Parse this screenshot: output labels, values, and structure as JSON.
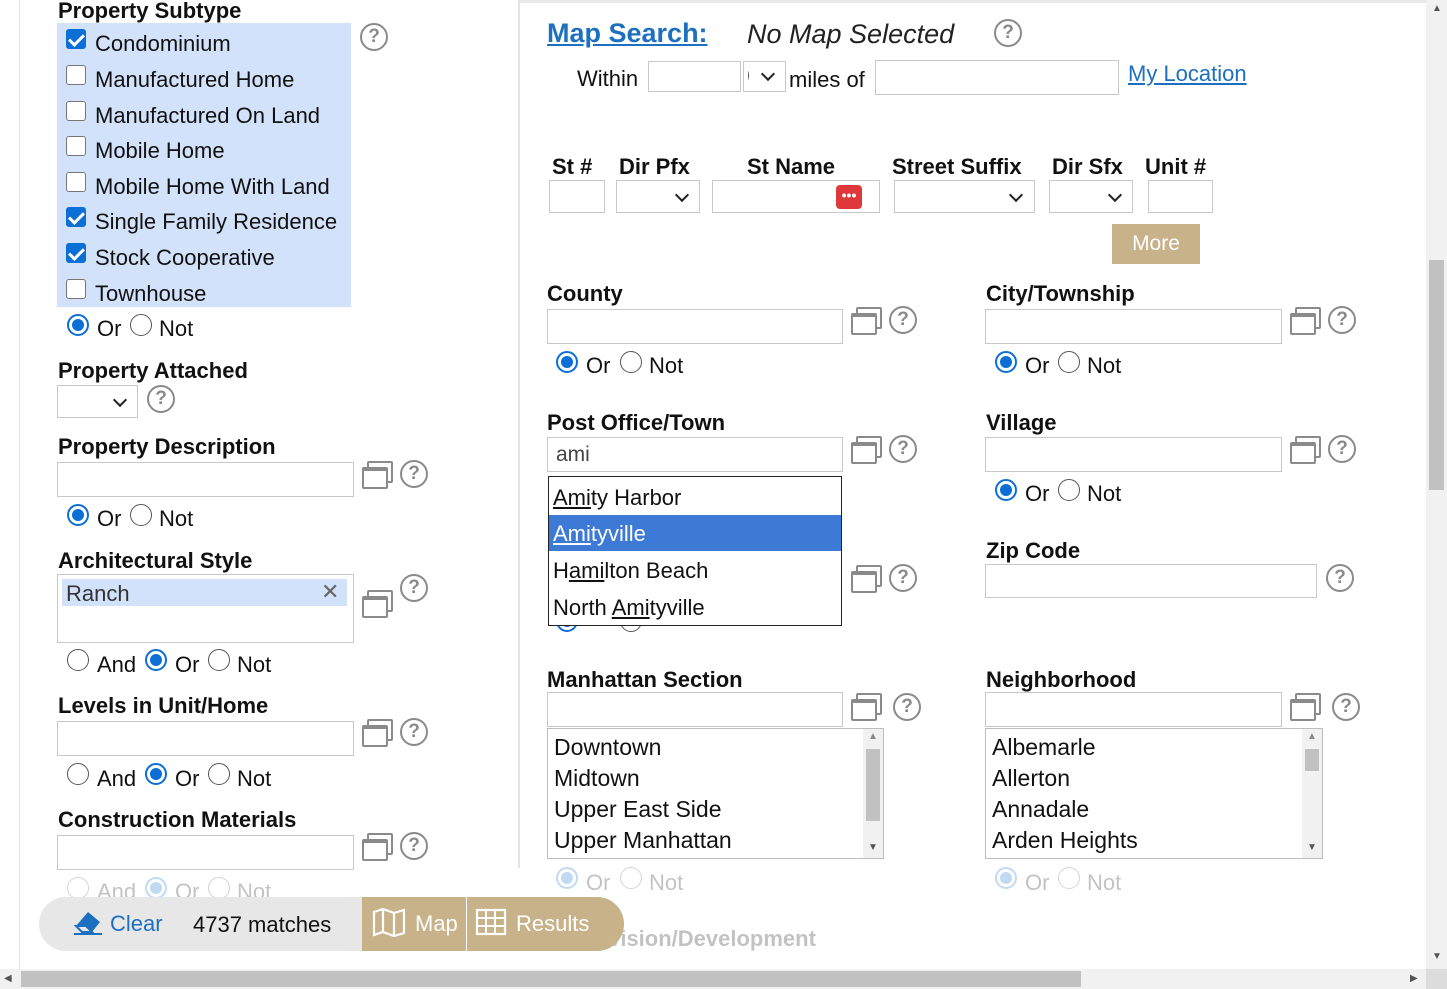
{
  "left": {
    "subtype": {
      "label": "Property Subtype",
      "options": [
        {
          "label": "Condominium",
          "checked": true
        },
        {
          "label": "Manufactured Home",
          "checked": false
        },
        {
          "label": "Manufactured On Land",
          "checked": false
        },
        {
          "label": "Mobile Home",
          "checked": false
        },
        {
          "label": "Mobile Home With Land",
          "checked": false
        },
        {
          "label": "Single Family Residence",
          "checked": true
        },
        {
          "label": "Stock Cooperative",
          "checked": true
        },
        {
          "label": "Townhouse",
          "checked": false
        }
      ]
    },
    "or": "Or",
    "not": "Not",
    "and": "And",
    "attached_label": "Property Attached",
    "description_label": "Property Description",
    "arch_label": "Architectural Style",
    "arch_value": "Ranch",
    "levels_label": "Levels in Unit/Home",
    "materials_label": "Construction Materials"
  },
  "help_glyph": "?",
  "map": {
    "title": "Map Search:",
    "status": "No Map Selected",
    "within": "Within",
    "miles_of": "miles of",
    "my_location": "My Location"
  },
  "address": {
    "st_num": "St #",
    "dir_pfx": "Dir Pfx",
    "st_name": "St Name",
    "suffix": "Street Suffix",
    "dir_sfx": "Dir Sfx",
    "unit": "Unit #",
    "more": "More"
  },
  "fields": {
    "county": "County",
    "city": "City/Township",
    "post_office": "Post Office/Town",
    "post_office_value": "ami",
    "village": "Village",
    "zip": "Zip Code",
    "manhattan": "Manhattan Section",
    "neighborhood": "Neighborhood",
    "subdivision": "Subdivision/Development"
  },
  "autocomplete": [
    {
      "match": "Ami",
      "rest": "ty Harbor",
      "prefix": ""
    },
    {
      "match": "Ami",
      "rest": "tyville",
      "prefix": ""
    },
    {
      "match": "ami",
      "rest": "lton Beach",
      "prefix": "H"
    },
    {
      "match": "Ami",
      "rest": "tyville",
      "prefix": "North "
    }
  ],
  "manhattan_options": [
    "Downtown",
    "Midtown",
    "Upper East Side",
    "Upper Manhattan"
  ],
  "neighborhood_options": [
    "Albemarle",
    "Allerton",
    "Annadale",
    "Arden Heights"
  ],
  "toolbar": {
    "clear": "Clear",
    "matches": "4737 matches",
    "map": "Map",
    "results": "Results"
  },
  "colors": {
    "accent": "#0b6fd6",
    "highlight": "#d3e2fb",
    "tan": "#c8b28a",
    "selected": "#3d7ad6"
  }
}
